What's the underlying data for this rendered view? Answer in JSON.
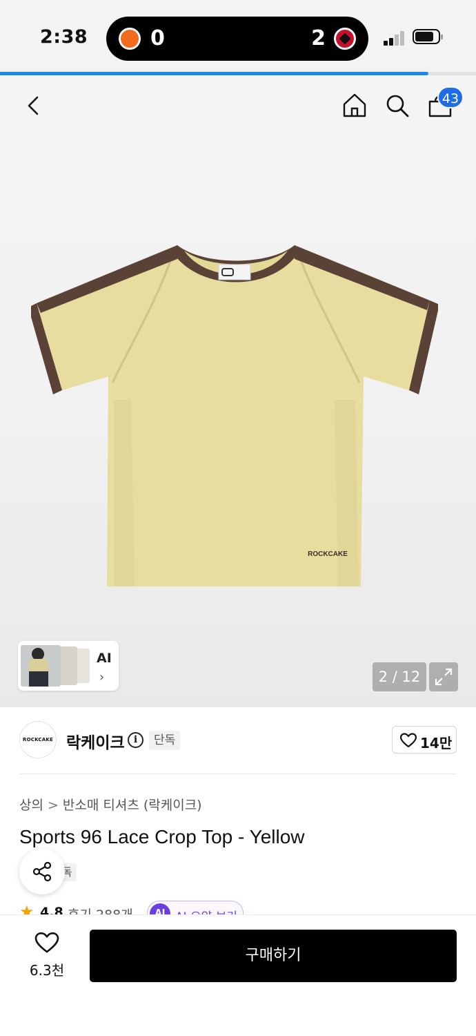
{
  "status": {
    "time": "2:38",
    "score_home": "0",
    "score_away": "2",
    "battery_level": 0.8
  },
  "page_progress": 0.9,
  "header": {
    "cart_count": "43"
  },
  "gallery": {
    "ai_label": "AI",
    "ai_chevron": "›",
    "counter": "2 / 12"
  },
  "brand": {
    "logo_text": "ROCKCAKE",
    "name": "락케이크",
    "info_glyph": "i",
    "exclusive": "단독",
    "likes": "14만"
  },
  "product": {
    "category": "상의",
    "separator": ">",
    "subcategory": "반소매 티셔츠 (락케이크)",
    "title": "Sports 96 Lace Crop Top - Yellow",
    "exclusive": "단독",
    "rating_star": "★",
    "rating": "4.8",
    "reviews": "후기 288개",
    "ai_badge": "AI",
    "ai_summary": "AI 요약 보기",
    "shirt_print": "ROCKCAKE"
  },
  "bottom_bar": {
    "wish_count": "6.3천",
    "buy_label": "구매하기"
  },
  "colors": {
    "accent_blue": "#1e6ce6",
    "ai_purple": "#6d3fe0",
    "shirt_body": "#e7dd9f",
    "shirt_trim": "#5a4236"
  }
}
